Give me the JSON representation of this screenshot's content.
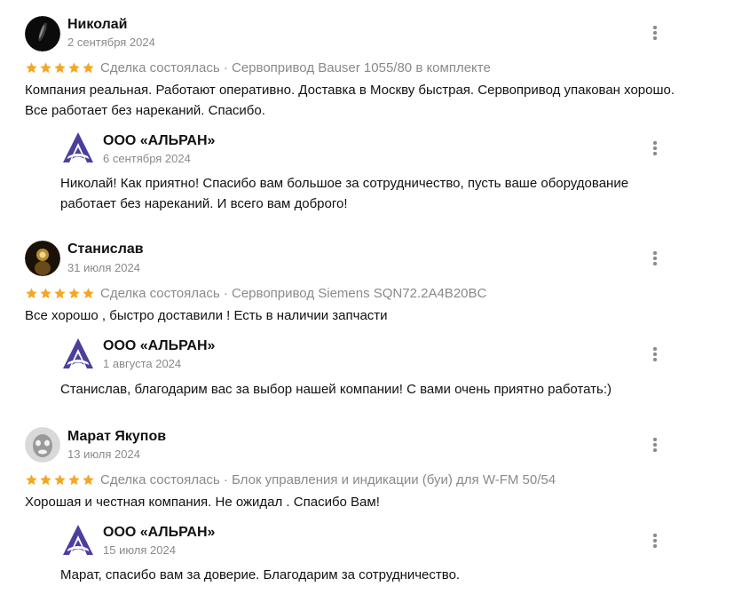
{
  "reviews": [
    {
      "author": "Николай",
      "date": "2 сентября 2024",
      "rating": 5,
      "meta": "Сделка состоялась · Сервопривод Bauser 1055/80 в комплекте",
      "text": "Компания реальная. Работают оперативно. Доставка в Москву быстрая. Сервопривод упакован хорошо. Все работает без нареканий. Спасибо.",
      "reply": {
        "author": "ООО «АЛЬРАН»",
        "date": "6 сентября 2024",
        "text": "Николай! Как приятно! Спасибо вам большое за сотрудничество, пусть ваше оборудование работает без нареканий. И всего вам доброго!"
      }
    },
    {
      "author": "Станислав",
      "date": "31 июля 2024",
      "rating": 5,
      "meta": "Сделка состоялась · Сервопривод Siemens SQN72.2A4B20BC",
      "text": "Все хорошо , быстро доставили ! Есть в наличии запчасти",
      "reply": {
        "author": "ООО «АЛЬРАН»",
        "date": "1 августа 2024",
        "text": "Станислав, благодарим вас за выбор нашей компании! С вами очень приятно работать:)"
      }
    },
    {
      "author": "Марат Якупов",
      "date": "13 июля 2024",
      "rating": 5,
      "meta": "Сделка состоялась · Блок управления и индикации (буи) для W-FM 50/54",
      "text": "Хорошая и честная компания. Не ожидал . Спасибо Вам!",
      "reply": {
        "author": "ООО «АЛЬРАН»",
        "date": "15 июля 2024",
        "text": "Марат, спасибо вам за доверие. Благодарим за сотрудничество."
      }
    }
  ],
  "colors": {
    "star": "#F5A623",
    "muted": "#8A8A8A",
    "logo": "#4B3F9E"
  },
  "icons": {
    "rating": "star-icon",
    "menu": "more-vertical-icon",
    "company": "alran-logo-icon"
  }
}
